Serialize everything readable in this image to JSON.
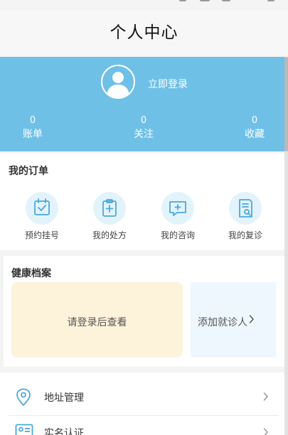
{
  "header": {
    "title": "个人中心"
  },
  "profile": {
    "login_label": "立即登录",
    "stats": [
      {
        "value": "0",
        "label": "账单"
      },
      {
        "value": "0",
        "label": "关注"
      },
      {
        "value": "0",
        "label": "收藏"
      }
    ]
  },
  "orders": {
    "title": "我的订单",
    "items": [
      {
        "label": "预约挂号",
        "icon": "calendar-check-icon"
      },
      {
        "label": "我的处方",
        "icon": "prescription-clipboard-icon"
      },
      {
        "label": "我的咨询",
        "icon": "consult-chat-icon"
      },
      {
        "label": "我的复诊",
        "icon": "revisit-document-icon"
      }
    ]
  },
  "health": {
    "title": "健康档案",
    "login_prompt": "请登录后查看",
    "add_patient": "添加就诊人"
  },
  "menu": {
    "items": [
      {
        "label": "地址管理",
        "icon": "location-pin-icon"
      },
      {
        "label": "实名认证",
        "icon": "id-card-icon"
      }
    ]
  },
  "colors": {
    "profile_bg": "#6ec0e7",
    "icon_accent": "#4aa8db",
    "icon_bg": "#e3f3fb",
    "login_card_bg": "#fdf3da",
    "add_card_bg": "#eef7fd"
  }
}
